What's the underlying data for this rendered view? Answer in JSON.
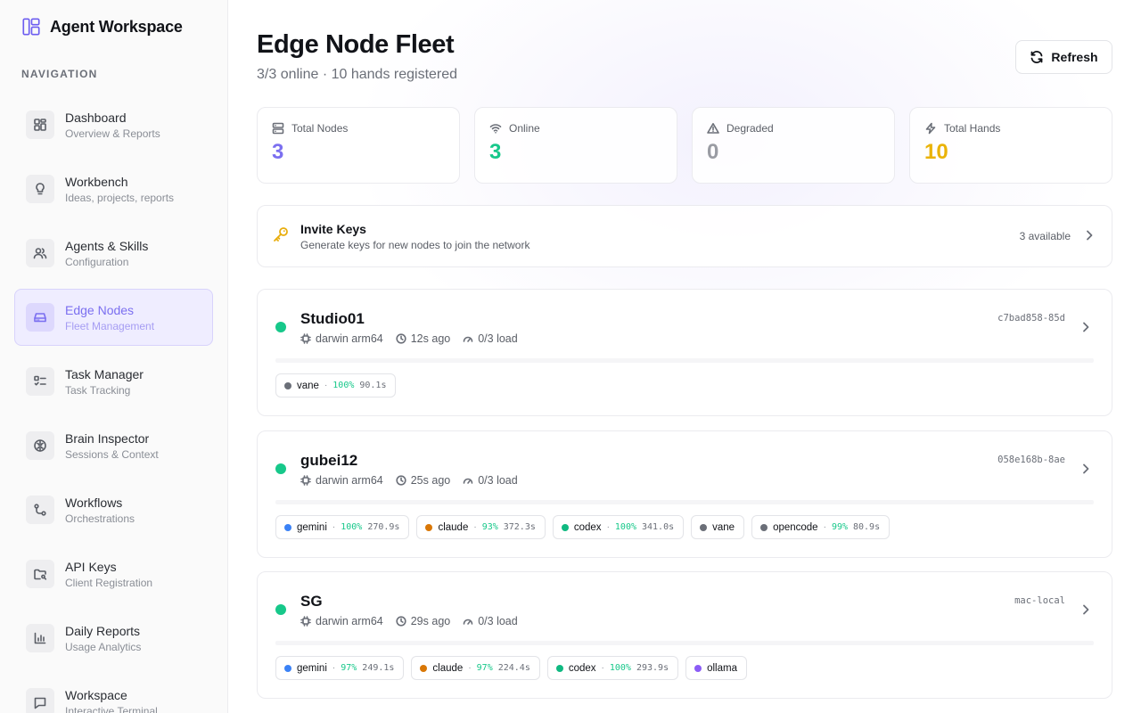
{
  "sidebar": {
    "brand": "Agent Workspace",
    "nav_heading": "NAVIGATION",
    "items": [
      {
        "label": "Dashboard",
        "sub": "Overview & Reports",
        "icon": "dashboard-icon"
      },
      {
        "label": "Workbench",
        "sub": "Ideas, projects, reports",
        "icon": "lightbulb-icon"
      },
      {
        "label": "Agents & Skills",
        "sub": "Configuration",
        "icon": "users-icon"
      },
      {
        "label": "Edge Nodes",
        "sub": "Fleet Management",
        "icon": "hard-drive-icon",
        "active": true
      },
      {
        "label": "Task Manager",
        "sub": "Task Tracking",
        "icon": "checklist-icon"
      },
      {
        "label": "Brain Inspector",
        "sub": "Sessions & Context",
        "icon": "brain-icon"
      },
      {
        "label": "Workflows",
        "sub": "Orchestrations",
        "icon": "workflow-icon"
      },
      {
        "label": "API Keys",
        "sub": "Client Registration",
        "icon": "key-folder-icon"
      },
      {
        "label": "Daily Reports",
        "sub": "Usage Analytics",
        "icon": "bar-chart-icon"
      },
      {
        "label": "Workspace",
        "sub": "Interactive Terminal",
        "icon": "chat-icon"
      }
    ]
  },
  "header": {
    "title": "Edge Node Fleet",
    "subtitle": "3/3 online · 10 hands registered",
    "refresh_label": "Refresh"
  },
  "stats": [
    {
      "label": "Total Nodes",
      "value": "3",
      "color": "#7b6ff0",
      "icon": "server-icon"
    },
    {
      "label": "Online",
      "value": "3",
      "color": "#17c88a",
      "icon": "wifi-icon"
    },
    {
      "label": "Degraded",
      "value": "0",
      "color": "#9a9ca3",
      "icon": "warning-icon"
    },
    {
      "label": "Total Hands",
      "value": "10",
      "color": "#eab308",
      "icon": "zap-icon"
    }
  ],
  "invite": {
    "title": "Invite Keys",
    "subtitle": "Generate keys for new nodes to join the network",
    "available": "3 available"
  },
  "nodes": [
    {
      "name": "Studio01",
      "id": "c7bad858-85d",
      "platform": "darwin arm64",
      "last_seen": "12s ago",
      "load": "0/3 load",
      "status_color": "#17c88a",
      "hands": [
        {
          "name": "vane",
          "color": "#6b6f78",
          "pct": "100%",
          "time": "90.1s"
        }
      ]
    },
    {
      "name": "gubei12",
      "id": "058e168b-8ae",
      "platform": "darwin arm64",
      "last_seen": "25s ago",
      "load": "0/3 load",
      "status_color": "#17c88a",
      "hands": [
        {
          "name": "gemini",
          "color": "#3b82f6",
          "pct": "100%",
          "time": "270.9s"
        },
        {
          "name": "claude",
          "color": "#d97706",
          "pct": "93%",
          "time": "372.3s"
        },
        {
          "name": "codex",
          "color": "#10b981",
          "pct": "100%",
          "time": "341.0s"
        },
        {
          "name": "vane",
          "color": "#6b6f78"
        },
        {
          "name": "opencode",
          "color": "#6b6f78",
          "pct": "99%",
          "time": "80.9s"
        }
      ]
    },
    {
      "name": "SG",
      "id": "mac-local",
      "platform": "darwin arm64",
      "last_seen": "29s ago",
      "load": "0/3 load",
      "status_color": "#17c88a",
      "hands": [
        {
          "name": "gemini",
          "color": "#3b82f6",
          "pct": "97%",
          "time": "249.1s"
        },
        {
          "name": "claude",
          "color": "#d97706",
          "pct": "97%",
          "time": "224.4s"
        },
        {
          "name": "codex",
          "color": "#10b981",
          "pct": "100%",
          "time": "293.9s"
        },
        {
          "name": "ollama",
          "color": "#8b5cf6"
        }
      ]
    }
  ]
}
